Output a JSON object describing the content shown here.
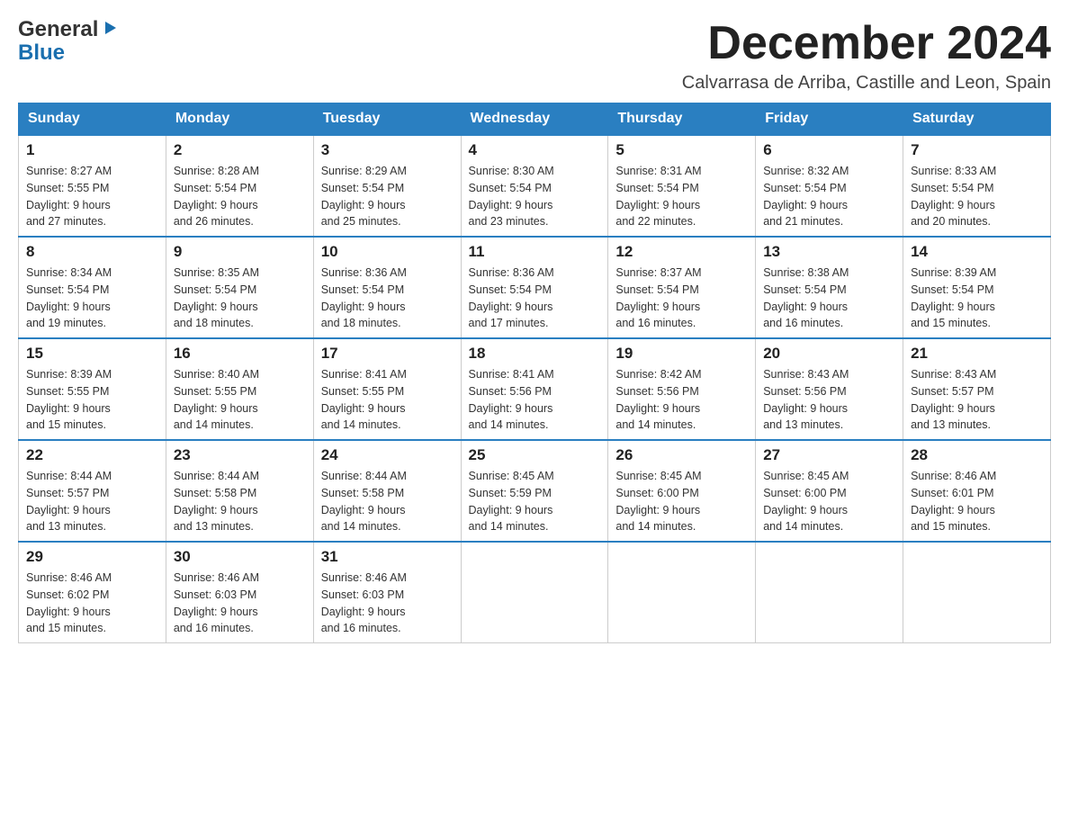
{
  "logo": {
    "general": "General",
    "blue": "Blue",
    "triangle": "▶"
  },
  "title": "December 2024",
  "subtitle": "Calvarrasa de Arriba, Castille and Leon, Spain",
  "weekdays": [
    "Sunday",
    "Monday",
    "Tuesday",
    "Wednesday",
    "Thursday",
    "Friday",
    "Saturday"
  ],
  "weeks": [
    [
      {
        "day": "1",
        "sunrise": "8:27 AM",
        "sunset": "5:55 PM",
        "daylight": "9 hours and 27 minutes."
      },
      {
        "day": "2",
        "sunrise": "8:28 AM",
        "sunset": "5:54 PM",
        "daylight": "9 hours and 26 minutes."
      },
      {
        "day": "3",
        "sunrise": "8:29 AM",
        "sunset": "5:54 PM",
        "daylight": "9 hours and 25 minutes."
      },
      {
        "day": "4",
        "sunrise": "8:30 AM",
        "sunset": "5:54 PM",
        "daylight": "9 hours and 23 minutes."
      },
      {
        "day": "5",
        "sunrise": "8:31 AM",
        "sunset": "5:54 PM",
        "daylight": "9 hours and 22 minutes."
      },
      {
        "day": "6",
        "sunrise": "8:32 AM",
        "sunset": "5:54 PM",
        "daylight": "9 hours and 21 minutes."
      },
      {
        "day": "7",
        "sunrise": "8:33 AM",
        "sunset": "5:54 PM",
        "daylight": "9 hours and 20 minutes."
      }
    ],
    [
      {
        "day": "8",
        "sunrise": "8:34 AM",
        "sunset": "5:54 PM",
        "daylight": "9 hours and 19 minutes."
      },
      {
        "day": "9",
        "sunrise": "8:35 AM",
        "sunset": "5:54 PM",
        "daylight": "9 hours and 18 minutes."
      },
      {
        "day": "10",
        "sunrise": "8:36 AM",
        "sunset": "5:54 PM",
        "daylight": "9 hours and 18 minutes."
      },
      {
        "day": "11",
        "sunrise": "8:36 AM",
        "sunset": "5:54 PM",
        "daylight": "9 hours and 17 minutes."
      },
      {
        "day": "12",
        "sunrise": "8:37 AM",
        "sunset": "5:54 PM",
        "daylight": "9 hours and 16 minutes."
      },
      {
        "day": "13",
        "sunrise": "8:38 AM",
        "sunset": "5:54 PM",
        "daylight": "9 hours and 16 minutes."
      },
      {
        "day": "14",
        "sunrise": "8:39 AM",
        "sunset": "5:54 PM",
        "daylight": "9 hours and 15 minutes."
      }
    ],
    [
      {
        "day": "15",
        "sunrise": "8:39 AM",
        "sunset": "5:55 PM",
        "daylight": "9 hours and 15 minutes."
      },
      {
        "day": "16",
        "sunrise": "8:40 AM",
        "sunset": "5:55 PM",
        "daylight": "9 hours and 14 minutes."
      },
      {
        "day": "17",
        "sunrise": "8:41 AM",
        "sunset": "5:55 PM",
        "daylight": "9 hours and 14 minutes."
      },
      {
        "day": "18",
        "sunrise": "8:41 AM",
        "sunset": "5:56 PM",
        "daylight": "9 hours and 14 minutes."
      },
      {
        "day": "19",
        "sunrise": "8:42 AM",
        "sunset": "5:56 PM",
        "daylight": "9 hours and 14 minutes."
      },
      {
        "day": "20",
        "sunrise": "8:43 AM",
        "sunset": "5:56 PM",
        "daylight": "9 hours and 13 minutes."
      },
      {
        "day": "21",
        "sunrise": "8:43 AM",
        "sunset": "5:57 PM",
        "daylight": "9 hours and 13 minutes."
      }
    ],
    [
      {
        "day": "22",
        "sunrise": "8:44 AM",
        "sunset": "5:57 PM",
        "daylight": "9 hours and 13 minutes."
      },
      {
        "day": "23",
        "sunrise": "8:44 AM",
        "sunset": "5:58 PM",
        "daylight": "9 hours and 13 minutes."
      },
      {
        "day": "24",
        "sunrise": "8:44 AM",
        "sunset": "5:58 PM",
        "daylight": "9 hours and 14 minutes."
      },
      {
        "day": "25",
        "sunrise": "8:45 AM",
        "sunset": "5:59 PM",
        "daylight": "9 hours and 14 minutes."
      },
      {
        "day": "26",
        "sunrise": "8:45 AM",
        "sunset": "6:00 PM",
        "daylight": "9 hours and 14 minutes."
      },
      {
        "day": "27",
        "sunrise": "8:45 AM",
        "sunset": "6:00 PM",
        "daylight": "9 hours and 14 minutes."
      },
      {
        "day": "28",
        "sunrise": "8:46 AM",
        "sunset": "6:01 PM",
        "daylight": "9 hours and 15 minutes."
      }
    ],
    [
      {
        "day": "29",
        "sunrise": "8:46 AM",
        "sunset": "6:02 PM",
        "daylight": "9 hours and 15 minutes."
      },
      {
        "day": "30",
        "sunrise": "8:46 AM",
        "sunset": "6:03 PM",
        "daylight": "9 hours and 16 minutes."
      },
      {
        "day": "31",
        "sunrise": "8:46 AM",
        "sunset": "6:03 PM",
        "daylight": "9 hours and 16 minutes."
      },
      null,
      null,
      null,
      null
    ]
  ],
  "labels": {
    "sunrise": "Sunrise:",
    "sunset": "Sunset:",
    "daylight": "Daylight:"
  }
}
